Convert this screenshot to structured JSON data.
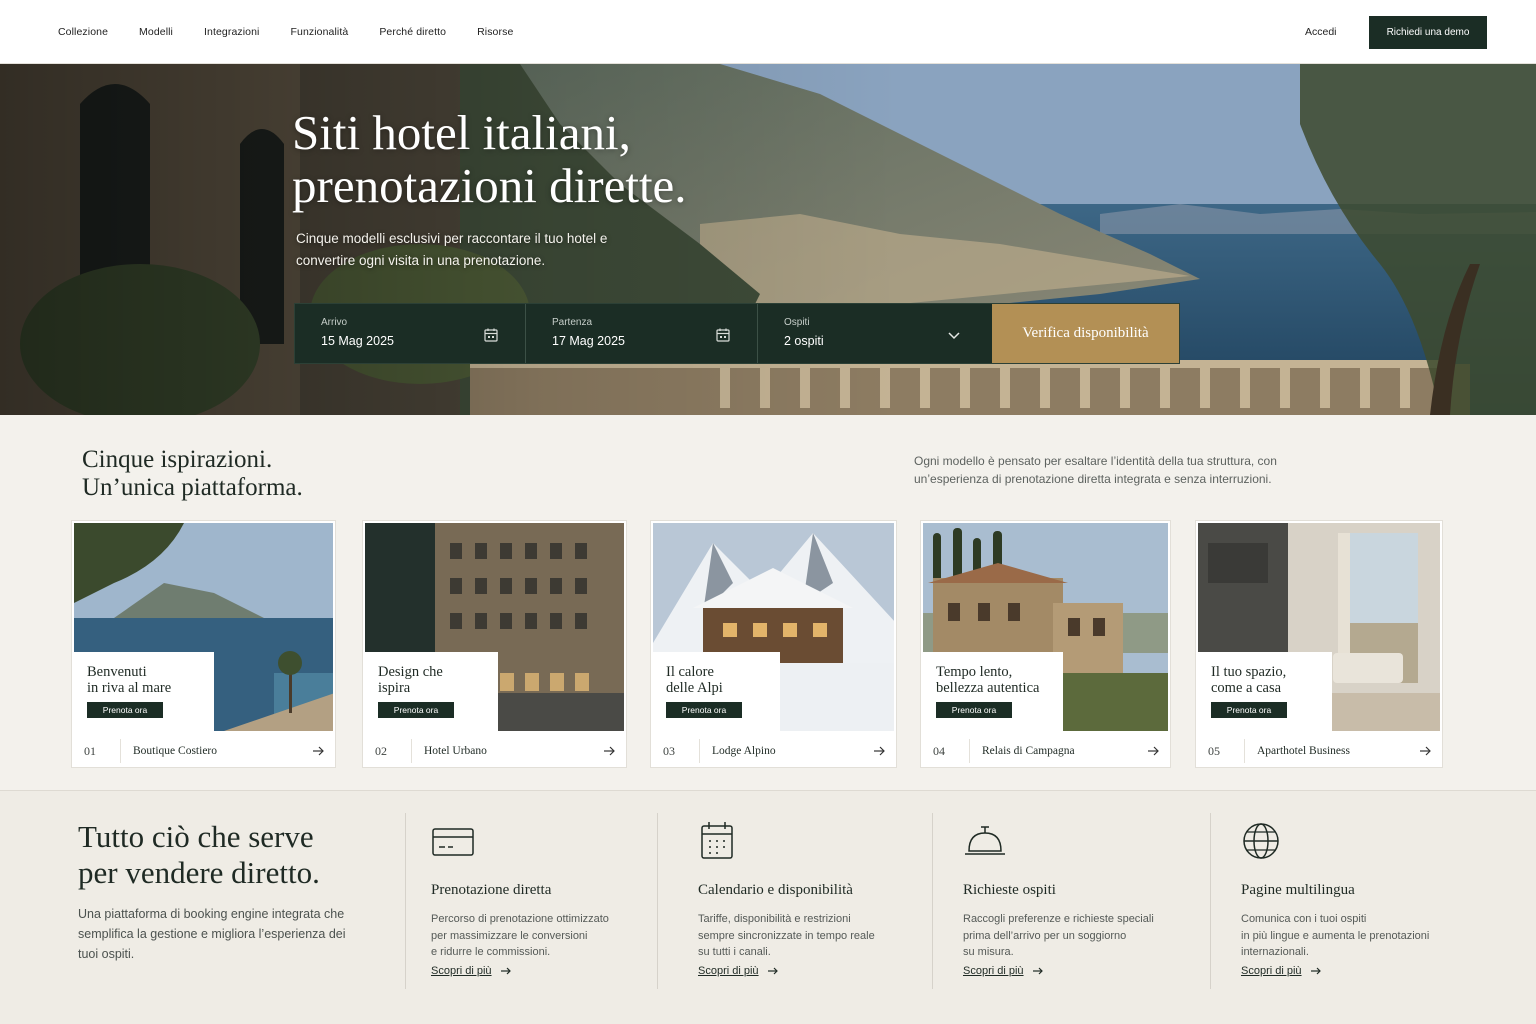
{
  "nav": {
    "links": [
      "Collezione",
      "Modelli",
      "Integrazioni",
      "Funzionalità",
      "Perché diretto",
      "Risorse"
    ],
    "login": "Accedi",
    "demo": "Richiedi una demo"
  },
  "hero": {
    "title": "Siti hotel italiani,\nprenotazioni dirette.",
    "subtitle": "Cinque modelli esclusivi per raccontare il tuo hotel e convertire ogni visita in una prenotazione.",
    "booking": {
      "arrival_label": "Arrivo",
      "arrival_value": "15 Mag 2025",
      "departure_label": "Partenza",
      "departure_value": "17 Mag 2025",
      "guests_label": "Ospiti",
      "guests_value": "2 ospiti",
      "button": "Verifica disponibilità"
    }
  },
  "models": {
    "title": "Cinque ispirazioni.\nUn’unica piattaforma.",
    "description": "Ogni modello è pensato per esaltare l’identità della tua struttura, con un’esperienza di prenotazione diretta integrata e senza interruzioni.",
    "cards": [
      {
        "number": "01",
        "name": "Boutique Costiero",
        "headline": "Benvenuti\nin riva al mare",
        "cta": "Prenota ora"
      },
      {
        "number": "02",
        "name": "Hotel Urbano",
        "headline": "Design che\nispira",
        "cta": "Prenota ora"
      },
      {
        "number": "03",
        "name": "Lodge Alpino",
        "headline": "Il calore\ndelle Alpi",
        "cta": "Prenota ora"
      },
      {
        "number": "04",
        "name": "Relais di Campagna",
        "headline": "Tempo lento,\nbellezza autentica",
        "cta": "Prenota ora"
      },
      {
        "number": "05",
        "name": "Aparthotel Business",
        "headline": "Il tuo spazio,\ncome a casa",
        "cta": "Prenota ora"
      }
    ]
  },
  "features": {
    "title": "Tutto ciò che serve\nper vendere diretto.",
    "description": "Una piattaforma di booking engine integrata che semplifica la gestione e migliora l’esperienza dei tuoi ospiti.",
    "items": [
      {
        "icon": "credit-card-icon",
        "name": "Prenotazione diretta",
        "text": "Percorso di prenotazione ottimizzato\nper massimizzare le conversioni\ne ridurre le commissioni.",
        "link": "Scopri di più"
      },
      {
        "icon": "calendar-icon",
        "name": "Calendario e disponibilità",
        "text": "Tariffe, disponibilità e restrizioni\nsempre sincronizzate in tempo reale\nsu tutti i canali.",
        "link": "Scopri di più"
      },
      {
        "icon": "service-bell-icon",
        "name": "Richieste ospiti",
        "text": "Raccogli preferenze e richieste speciali\nprima dell’arrivo per un soggiorno\nsu misura.",
        "link": "Scopri di più"
      },
      {
        "icon": "globe-icon",
        "name": "Pagine multilingua",
        "text": "Comunica con i tuoi ospiti\nin più lingue e aumenta le prenotazioni\ninternazionali.",
        "link": "Scopri di più"
      }
    ]
  },
  "colors": {
    "brand_dark": "#1b2d25",
    "accent_gold": "#b39055",
    "background": "#f3f1ec"
  }
}
